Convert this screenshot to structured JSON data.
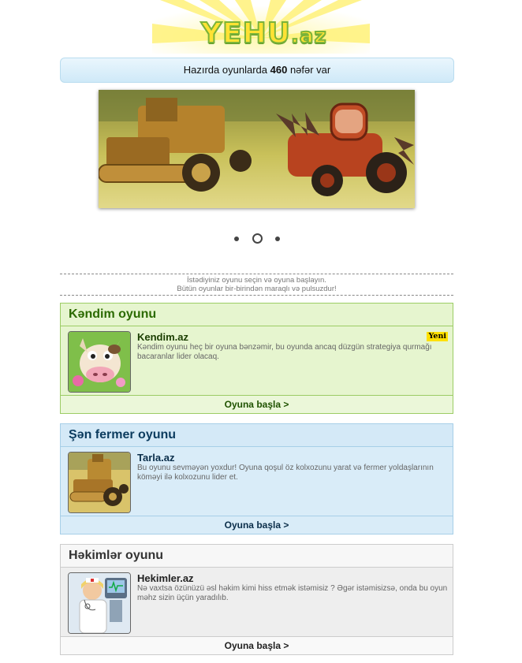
{
  "logo": {
    "name": "YEHU",
    "tld": ".az"
  },
  "online": {
    "prefix": "Hazırda oyunlarda",
    "count": "460",
    "suffix": "nəfər var"
  },
  "banner": {
    "slides": 3,
    "active_slide": 2
  },
  "info": {
    "line1": "İstədiyiniz oyunu seçin və oyuna başlayın.",
    "line2": "Bütün oyunlar bir-birindən maraqlı və pulsuzdur!"
  },
  "games": [
    {
      "header": "Kəndim oyunu",
      "name": "Kendim.az",
      "badge": "Yeni",
      "description": "Kəndim oyunu heç bir oyuna bənzəmir, bu oyunda ancaq düzgün strategiya qurmağı bacaranlar lider olacaq.",
      "play_label": "Oyuna başla >",
      "thumb_icon": "cow-icon"
    },
    {
      "header": "Şən fermer oyunu",
      "name": "Tarla.az",
      "description": "Bu oyunu sevməyən yoxdur! Oyuna qoşul öz kolxozunu yarat və fermer yoldaşlarının köməyi ilə kolxozunu lider et.",
      "play_label": "Oyuna başla >",
      "thumb_icon": "harvester-icon"
    },
    {
      "header": "Həkimlər oyunu",
      "name": "Hekimler.az",
      "description": "Nə vaxtsa özünüzü əsl həkim kimi hiss etmək istəmisiz ? Əgər istəmisizsə, onda bu oyun məhz sizin üçün yaradılıb.",
      "play_label": "Oyuna başla >",
      "thumb_icon": "nurse-icon"
    }
  ]
}
